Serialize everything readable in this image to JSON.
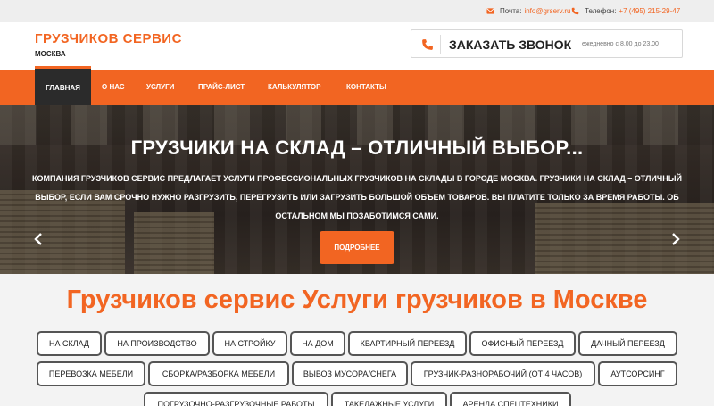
{
  "topbar": {
    "mail_label": "Почта:",
    "mail_value": "info@grserv.ru",
    "phone_label": "Телефон:",
    "phone_value": "+7 (495) 215-29-47"
  },
  "header": {
    "brand": "ГРУЗЧИКОВ СЕРВИС",
    "city": "МОСКВА",
    "callback_label": "ЗАКАЗАТЬ ЗВОНОК",
    "callback_hours": "ежедневно с 8.00 до 23.00"
  },
  "nav": {
    "items": [
      {
        "label": "ГЛАВНАЯ"
      },
      {
        "label": "О НАС"
      },
      {
        "label": "УСЛУГИ"
      },
      {
        "label": "ПРАЙС-ЛИСТ"
      },
      {
        "label": "КАЛЬКУЛЯТОР"
      },
      {
        "label": "КОНТАКТЫ"
      }
    ],
    "active_index": 0
  },
  "hero": {
    "title": "ГРУЗЧИКИ НА СКЛАД – ОТЛИЧНЫЙ ВЫБОР...",
    "line1": "КОМПАНИЯ ГРУЗЧИКОВ СЕРВИС ПРЕДЛАГАЕТ УСЛУГИ ПРОФЕССИОНАЛЬНЫХ ГРУЗЧИКОВ НА СКЛАДЫ В ГОРОДЕ МОСКВА. ГРУЗЧИКИ НА СКЛАД – ОТЛИЧНЫЙ",
    "line2": "ВЫБОР, ЕСЛИ ВАМ СРОЧНО НУЖНО РАЗГРУЗИТЬ, ПЕРЕГРУЗИТЬ ИЛИ ЗАГРУЗИТЬ БОЛЬШОЙ ОБЪЕМ ТОВАРОВ. ВЫ ПЛАТИТЕ ТОЛЬКО ЗА ВРЕМЯ РАБОТЫ. ОБ",
    "line3": "ОСТАЛЬНОМ МЫ ПОЗАБОТИМСЯ САМИ.",
    "button": "ПОДРОБНЕЕ"
  },
  "services": {
    "title": "Грузчиков сервис Услуги грузчиков в Москве",
    "tags": [
      "НА СКЛАД",
      "НА ПРОИЗВОДСТВО",
      "НА СТРОЙКУ",
      "НА ДОМ",
      "КВАРТИРНЫЙ ПЕРЕЕЗД",
      "ОФИСНЫЙ ПЕРЕЕЗД",
      "ДАЧНЫЙ ПЕРЕЕЗД",
      "ПЕРЕВОЗКА МЕБЕЛИ",
      "СБОРКА/РАЗБОРКА МЕБЕЛИ",
      "ВЫВОЗ МУСОРА/СНЕГА",
      "ГРУЗЧИК-РАЗНОРАБОЧИЙ (ОТ 4 ЧАСОВ)",
      "АУТСОРСИНГ",
      "ПОГРУЗОЧНО-РАЗГРУЗОЧНЫЕ РАБОТЫ",
      "ТАКЕЛАЖНЫЕ УСЛУГИ",
      "АРЕНДА СПЕЦТЕХНИКИ"
    ]
  },
  "colors": {
    "accent": "#f26522",
    "nav_active": "#2b2b2b"
  },
  "icons": {
    "mail": "envelope-icon",
    "phone": "phone-icon",
    "prev": "chevron-left-icon",
    "next": "chevron-right-icon"
  }
}
